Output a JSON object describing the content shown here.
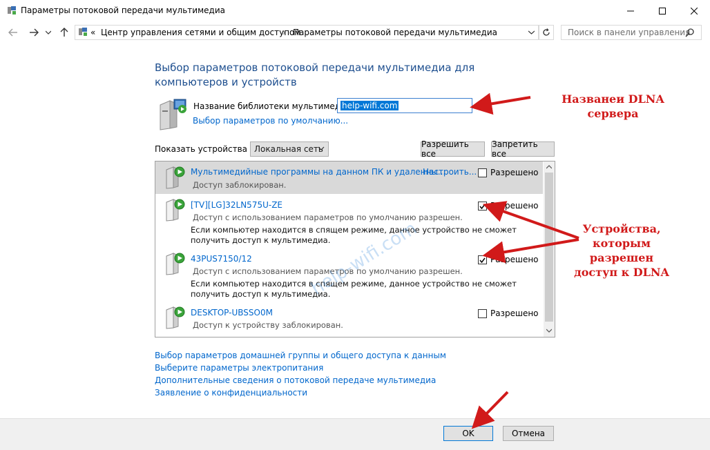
{
  "window": {
    "title": "Параметры потоковой передачи мультимедиа"
  },
  "address": {
    "overflow": "«",
    "crumbs": [
      "Центр управления сетями и общим доступом",
      "Параметры потоковой передачи мультимедиа"
    ],
    "search_placeholder": "Поиск в панели управления"
  },
  "main": {
    "heading": "Выбор параметров потоковой передачи мультимедиа для компьютеров и устройств",
    "library_label": "Название библиотеки мультимедиа:",
    "library_value": "help-wifi.com",
    "defaults_link": "Выбор параметров по умолчанию...",
    "show_devices_label": "Показать устройства на:",
    "show_devices_value": "Локальная сеть",
    "allow_all": "Разрешить все",
    "deny_all": "Запретить все"
  },
  "devices": [
    {
      "name": "Мультимедийные программы на данном ПК и удаленны...",
      "configure": "Настроить...",
      "status": "Доступ заблокирован.",
      "note": "",
      "checked": false,
      "check_label": "Разрешено"
    },
    {
      "name": "[TV][LG]32LN575U-ZE",
      "configure": "",
      "status": "Доступ с использованием параметров по умолчанию разрешен.",
      "note": "Если компьютер находится в спящем режиме, данное устройство не сможет получить доступ к мультимедиа.",
      "checked": true,
      "check_label": "Разрешено"
    },
    {
      "name": "43PUS7150/12",
      "configure": "",
      "status": "Доступ с использованием параметров по умолчанию разрешен.",
      "note": "Если компьютер находится в спящем режиме, данное устройство не сможет получить доступ к мультимедиа.",
      "checked": true,
      "check_label": "Разрешено"
    },
    {
      "name": "DESKTOP-UBSSO0M",
      "configure": "",
      "status": "Доступ к устройству заблокирован.",
      "note": "",
      "checked": false,
      "check_label": "Разрешено"
    }
  ],
  "links": [
    "Выбор параметров домашней группы и общего доступа к данным",
    "Выберите параметры электропитания",
    "Дополнительные сведения о потоковой передаче мультимедиа",
    "Заявление о конфиденциальности"
  ],
  "footer": {
    "ok": "OK",
    "cancel": "Отмена"
  },
  "annotations": {
    "server_name": "Названеи DLNA сервера",
    "devices_allowed": "Устройства, которым разрешен доступ к DLNA",
    "watermark": "help-wifi.com"
  },
  "colors": {
    "accent": "#1e4f8f",
    "link": "#0066cc",
    "annotation": "#d11a1a"
  },
  "icons": {
    "app": "network-media-icon",
    "back": "arrow-left-icon",
    "forward": "arrow-right-icon",
    "up": "arrow-up-icon",
    "refresh": "refresh-icon",
    "search": "search-icon",
    "device": "media-device-icon"
  }
}
